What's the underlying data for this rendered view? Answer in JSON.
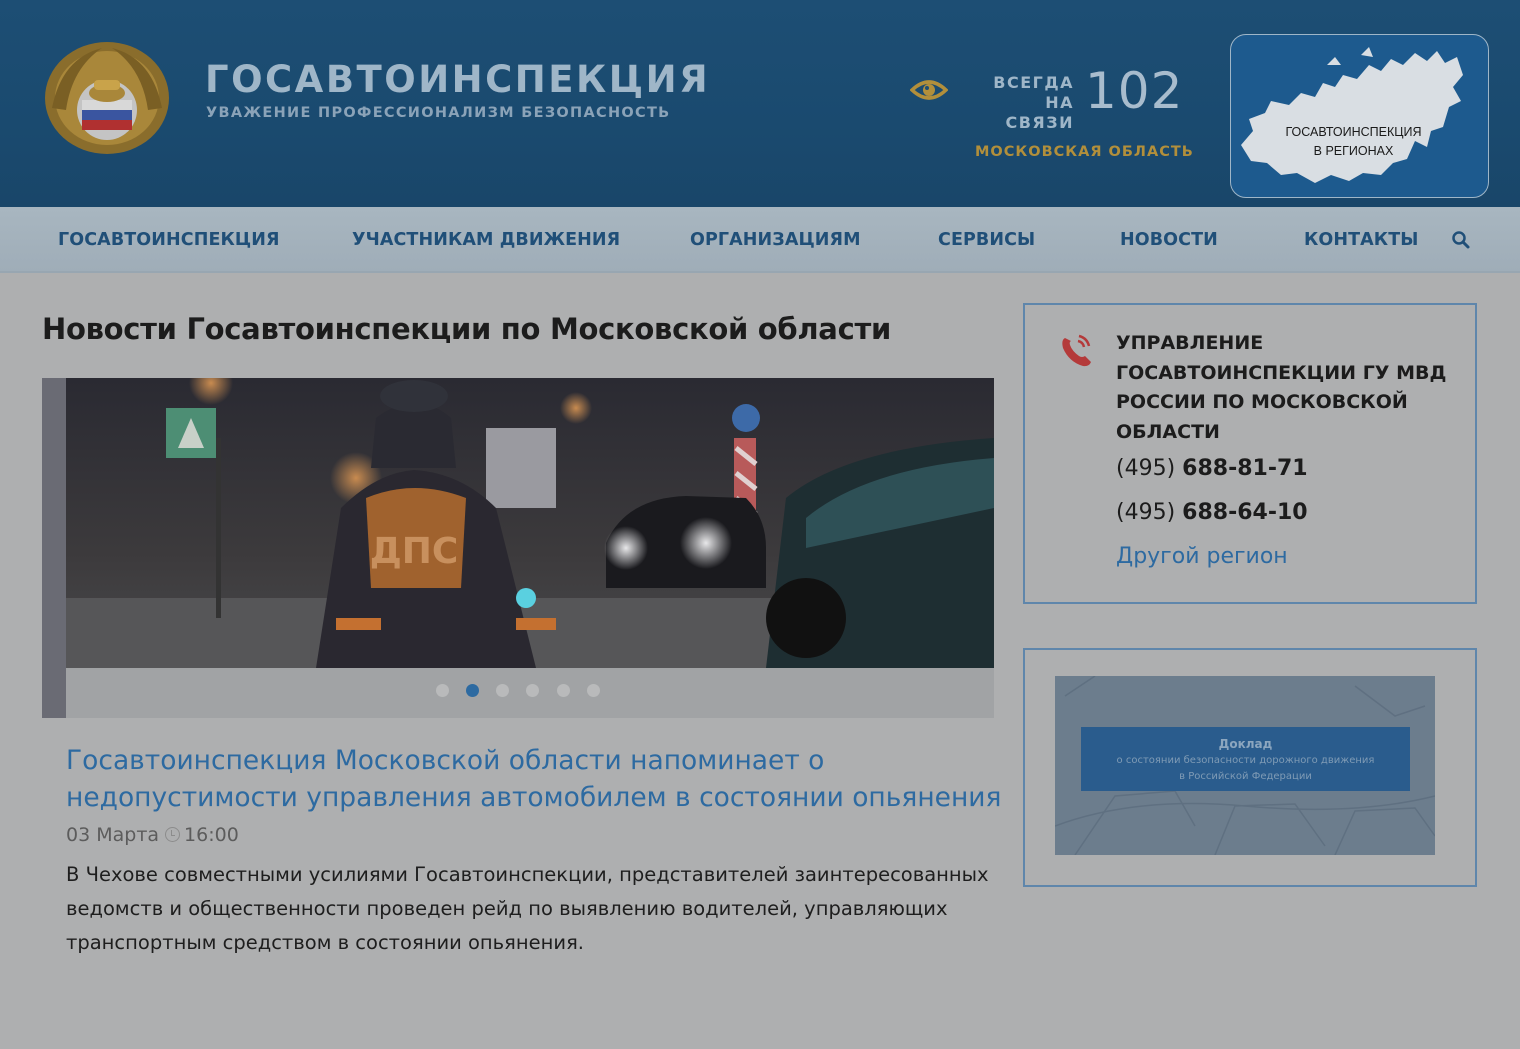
{
  "header": {
    "brand_title": "ГОСАВТОИНСПЕКЦИЯ",
    "brand_slogan": "УВАЖЕНИЕ ПРОФЕССИОНАЛИЗМ БЕЗОПАСНОСТЬ",
    "always_line1": "ВСЕГДА",
    "always_line2": "НА СВЯЗИ",
    "hotline": "102",
    "region": "МОСКОВСКАЯ ОБЛАСТЬ",
    "regions_line1": "ГОСАВТОИНСПЕКЦИЯ",
    "regions_line2": "В РЕГИОНАХ"
  },
  "nav": {
    "items": [
      {
        "label": "ГОСАВТОИНСПЕКЦИЯ"
      },
      {
        "label": "УЧАСТНИКАМ ДВИЖЕНИЯ"
      },
      {
        "label": "ОРГАНИЗАЦИЯМ"
      },
      {
        "label": "СЕРВИСЫ"
      },
      {
        "label": "НОВОСТИ"
      },
      {
        "label": "КОНТАКТЫ"
      }
    ],
    "search_icon": "search-icon"
  },
  "main": {
    "page_title": "Новости Госавтоинспекции по Московской области",
    "slider": {
      "slides": 6,
      "active_slide": 2,
      "photo_text": "ДПС"
    },
    "news": {
      "title": "Госавтоинспекция Московской области напоминает о недопустимости управления автомобилем в состоянии опьянения",
      "date": "03 Марта",
      "time": "16:00",
      "text": "В Чехове совместными усилиями Госавтоинспекции, представителей заинтересованных ведомств и общественности проведен рейд по выявлению водителей, управляющих транспортным средством в состоянии опьянения."
    }
  },
  "sidebar": {
    "contact_title": "УПРАВЛЕНИЕ ГОСАВТОИНСПЕКЦИИ ГУ МВД РОССИИ ПО МОСКОВСКОЙ ОБЛАСТИ",
    "phones": [
      {
        "code": "(495)",
        "number": "688-81-71"
      },
      {
        "code": "(495)",
        "number": "688-64-10"
      }
    ],
    "other_region": "Другой регион",
    "report": {
      "title": "Доклад",
      "line1": "о состоянии безопасности дорожного движения",
      "line2": "в Российской Федерации"
    }
  },
  "colors": {
    "header_bg": "#1d4e74",
    "nav_text": "#204f78",
    "link": "#2d6aa1",
    "accent_gold": "#b28f3b",
    "box_border": "#5f86ab"
  }
}
